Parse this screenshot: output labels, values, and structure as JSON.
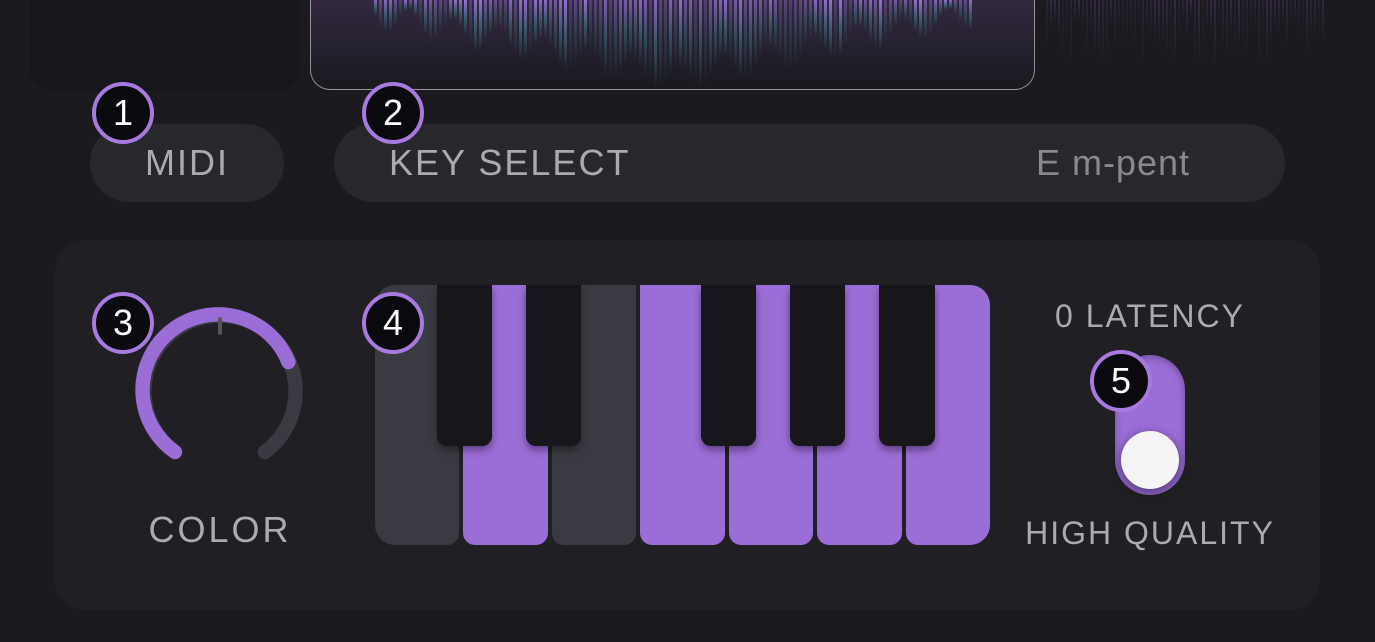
{
  "top": {
    "midi_label": "MIDI",
    "key_select_label": "KEY SELECT",
    "key_select_value": "E m-pent"
  },
  "color": {
    "label": "COLOR",
    "value_fraction": 0.75
  },
  "keyboard": {
    "white_active": [
      false,
      true,
      false,
      true,
      true,
      true,
      true
    ],
    "black_positions": [
      10,
      24.5,
      53,
      67.5,
      82
    ]
  },
  "quality": {
    "top_label": "0 LATENCY",
    "bottom_label": "HIGH QUALITY",
    "state": "high_quality"
  },
  "badges": [
    "1",
    "2",
    "3",
    "4",
    "5"
  ],
  "colors": {
    "accent": "#9b6dd7",
    "text": "#aaaab0"
  }
}
